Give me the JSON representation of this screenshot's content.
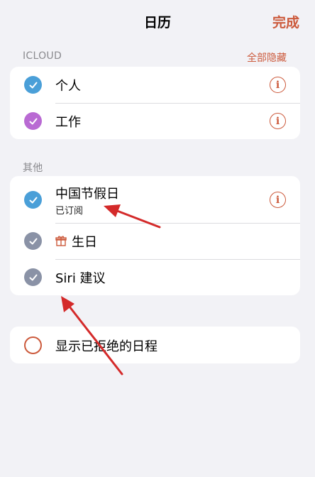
{
  "nav": {
    "title": "日历",
    "done_label": "完成"
  },
  "sections": [
    {
      "header": "ICLOUD",
      "action": "全部隐藏",
      "rows": [
        {
          "label": "个人",
          "color": "#4a9fd8",
          "checked": true
        },
        {
          "label": "工作",
          "color": "#b96ad3",
          "checked": true
        }
      ]
    },
    {
      "header": "其他",
      "rows": [
        {
          "label": "中国节假日",
          "subtitle": "已订阅",
          "color": "#4a9fd8",
          "checked": true
        },
        {
          "label": "生日",
          "color": "#8a92a6",
          "checked": true,
          "icon": "gift-icon"
        },
        {
          "label": "Siri 建议",
          "color": "#8a92a6",
          "checked": true
        }
      ]
    }
  ],
  "declined": {
    "label": "显示已拒绝的日程",
    "checked": false
  },
  "colors": {
    "accent": "#cc5a3c",
    "background": "#f2f2f6",
    "arrow": "#d42a2a"
  }
}
